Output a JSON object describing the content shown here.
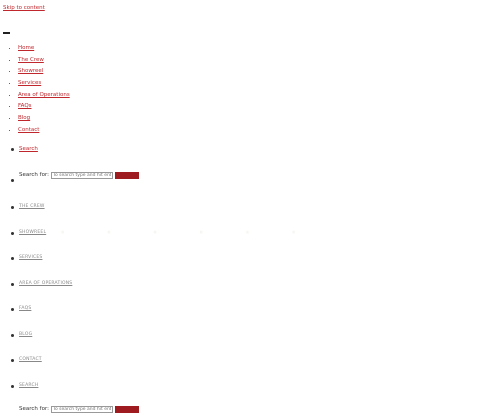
{
  "skip_link": "Skip to content",
  "nav": {
    "items": [
      {
        "label": "Home"
      },
      {
        "label": "The Crew"
      },
      {
        "label": "Showreel"
      },
      {
        "label": "Services"
      },
      {
        "label": "Area of Operations"
      },
      {
        "label": "FAQs"
      },
      {
        "label": "Blog"
      },
      {
        "label": "Contact"
      }
    ],
    "search_label": "Search"
  },
  "search_form_top": {
    "label": "Search for:",
    "placeholder": "To search type and hit enter"
  },
  "secondary_nav": {
    "items": [
      {
        "label": "THE CREW"
      },
      {
        "label": "SHOWREEL"
      },
      {
        "label": "SERVICES"
      },
      {
        "label": "AREA OF OPERATIONS"
      },
      {
        "label": "FAQS"
      },
      {
        "label": "BLOG"
      },
      {
        "label": "CONTACT"
      },
      {
        "label": "SEARCH"
      }
    ]
  },
  "search_form_bottom": {
    "label": "Search for:",
    "placeholder": "To search type and hit enter"
  },
  "colors": {
    "link": "#c0272d",
    "button": "#9e1c20"
  }
}
